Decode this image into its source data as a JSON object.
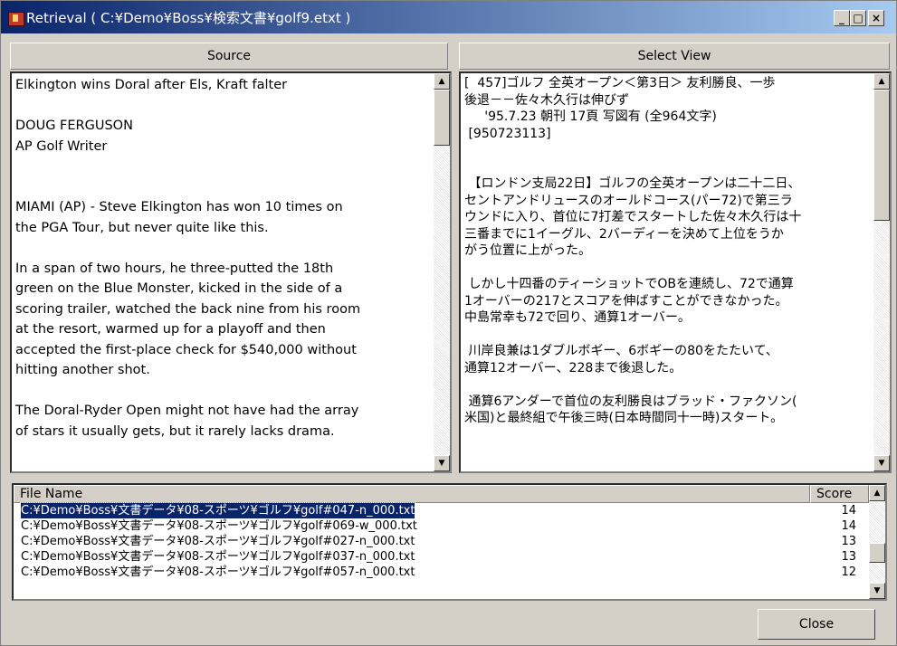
{
  "window": {
    "title": "Retrieval ( C:¥Demo¥Boss¥検索文書¥golf9.etxt )",
    "controls": [
      "_",
      "□",
      "×"
    ]
  },
  "source": {
    "header": "Source",
    "text": "Elkington wins Doral after Els, Kraft falter\n\nDOUG FERGUSON\nAP Golf Writer\n\n\nMIAMI (AP) - Steve Elkington has won 10 times on\nthe PGA Tour, but never quite like this.\n\nIn a span of two hours, he three-putted the 18th\ngreen on the Blue Monster, kicked in the side of a\nscoring trailer, watched the back nine from his room\nat the resort, warmed up for a playoff and then\naccepted the first-place check for $540,000 without\nhitting another shot.\n\nThe Doral-Ryder Open might not have had the array\nof stars it usually gets, but it rarely lacks drama."
  },
  "select_view": {
    "header": "Select View",
    "text": "[  457]ゴルフ 全英オープン＜第3日＞ 友利勝良、一歩\n後退－－佐々木久行は伸びず\n     '95.7.23 朝刊 17頁 写図有 (全964文字)\n [950723113]\n\n\n 【ロンドン支局22日】ゴルフの全英オープンは二十二日、\nセントアンドリュースのオールドコース(パー72)で第三ラ\nウンドに入り、首位に7打差でスタートした佐々木久行は十\n三番までに1イーグル、2バーディーを決めて上位をうか\nがう位置に上がった。\n\n しかし十四番のティーショットでOBを連続し、72で通算\n1オーバーの217とスコアを伸ばすことができなかった。\n中島常幸も72で回り、通算1オーバー。\n\n 川岸良兼は1ダブルボギー、6ボギーの80をたたいて、\n通算12オーバー、228まで後退した。\n\n 通算6アンダーで首位の友利勝良はブラッド・ファクソン(\n米国)と最終組で午後三時(日本時間同十一時)スタート。"
  },
  "file_list": {
    "col_name": "File Name",
    "col_score": "Score",
    "rows": [
      {
        "name": "C:¥Demo¥Boss¥文書データ¥08-スポーツ¥ゴルフ¥golf#047-n_000.txt",
        "score": "14",
        "selected": true
      },
      {
        "name": "C:¥Demo¥Boss¥文書データ¥08-スポーツ¥ゴルフ¥golf#069-w_000.txt",
        "score": "14",
        "selected": false
      },
      {
        "name": "C:¥Demo¥Boss¥文書データ¥08-スポーツ¥ゴルフ¥golf#027-n_000.txt",
        "score": "13",
        "selected": false
      },
      {
        "name": "C:¥Demo¥Boss¥文書データ¥08-スポーツ¥ゴルフ¥golf#037-n_000.txt",
        "score": "13",
        "selected": false
      },
      {
        "name": "C:¥Demo¥Boss¥文書データ¥08-スポーツ¥ゴルフ¥golf#057-n_000.txt",
        "score": "12",
        "selected": false
      }
    ]
  },
  "buttons": {
    "close": "Close"
  }
}
